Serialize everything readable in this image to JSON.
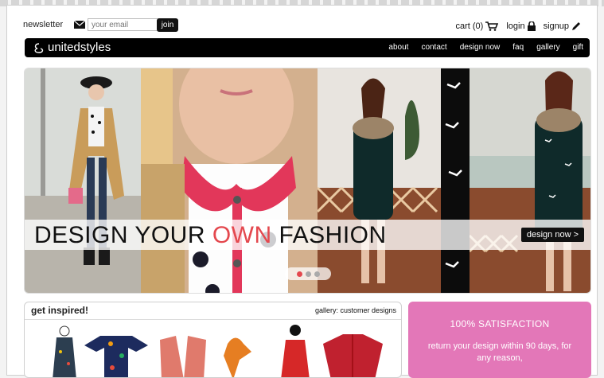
{
  "newsletter": {
    "label": "newsletter",
    "placeholder": "your email",
    "join_label": "join"
  },
  "util": {
    "cart": "cart (0)",
    "login": "login",
    "signup": "signup"
  },
  "brand": {
    "name": "unitedstyles"
  },
  "nav": {
    "items": [
      "about",
      "contact",
      "design now",
      "faq",
      "gallery",
      "gift"
    ]
  },
  "hero": {
    "headline_part1": "DESIGN YOUR ",
    "headline_accent": "OWN",
    "headline_part2": " FASHION",
    "cta": "design now >",
    "slide_count": 3,
    "active_slide": 1
  },
  "inspired": {
    "title": "get inspired!",
    "link": "gallery: customer designs"
  },
  "satisfaction": {
    "title": "100% SATISFACTION",
    "body": "return your design within 90 days, for any reason,"
  },
  "colors": {
    "accent": "#e4484e",
    "pink_panel": "#e377b8",
    "nav_bg": "#000000"
  }
}
